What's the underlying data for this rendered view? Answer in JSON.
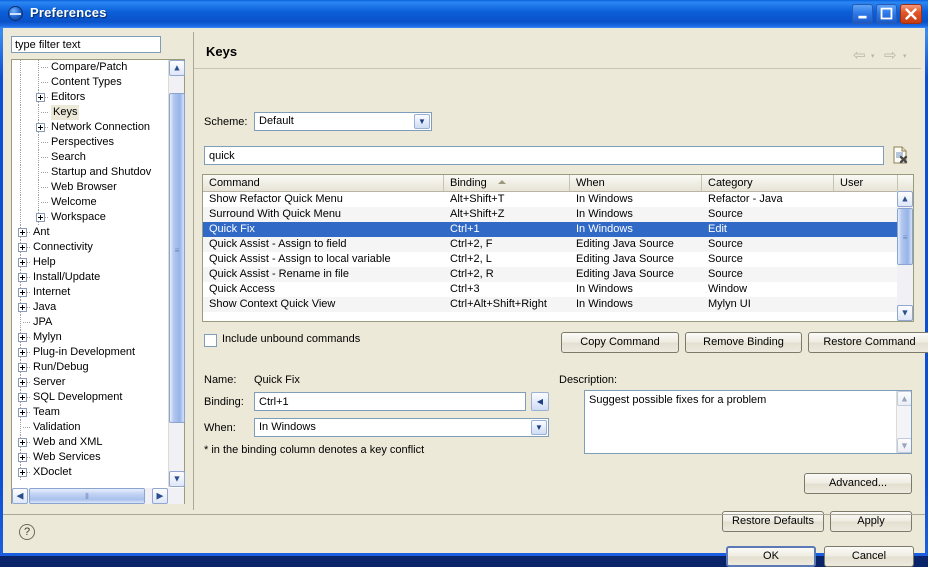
{
  "window": {
    "title": "Preferences",
    "icon": "eclipse-globe-icon",
    "minimize_label": "_",
    "maximize_label": "□",
    "close_label": "✕"
  },
  "sidebar": {
    "filter": {
      "value": "type filter text",
      "placeholder": "type filter text"
    },
    "items": [
      {
        "label": "Compare/Patch",
        "depth": 2,
        "expandable": false,
        "selected": false
      },
      {
        "label": "Content Types",
        "depth": 2,
        "expandable": false,
        "selected": false
      },
      {
        "label": "Editors",
        "depth": 2,
        "expandable": true,
        "selected": false
      },
      {
        "label": "Keys",
        "depth": 2,
        "expandable": false,
        "selected": true
      },
      {
        "label": "Network Connection",
        "depth": 2,
        "expandable": true,
        "selected": false
      },
      {
        "label": "Perspectives",
        "depth": 2,
        "expandable": false,
        "selected": false
      },
      {
        "label": "Search",
        "depth": 2,
        "expandable": false,
        "selected": false
      },
      {
        "label": "Startup and Shutdov",
        "depth": 2,
        "expandable": false,
        "selected": false
      },
      {
        "label": "Web Browser",
        "depth": 2,
        "expandable": false,
        "selected": false
      },
      {
        "label": "Welcome",
        "depth": 2,
        "expandable": false,
        "selected": false
      },
      {
        "label": "Workspace",
        "depth": 2,
        "expandable": true,
        "selected": false
      },
      {
        "label": "Ant",
        "depth": 1,
        "expandable": true,
        "selected": false
      },
      {
        "label": "Connectivity",
        "depth": 1,
        "expandable": true,
        "selected": false
      },
      {
        "label": "Help",
        "depth": 1,
        "expandable": true,
        "selected": false
      },
      {
        "label": "Install/Update",
        "depth": 1,
        "expandable": true,
        "selected": false
      },
      {
        "label": "Internet",
        "depth": 1,
        "expandable": true,
        "selected": false
      },
      {
        "label": "Java",
        "depth": 1,
        "expandable": true,
        "selected": false
      },
      {
        "label": "JPA",
        "depth": 1,
        "expandable": false,
        "selected": false
      },
      {
        "label": "Mylyn",
        "depth": 1,
        "expandable": true,
        "selected": false
      },
      {
        "label": "Plug-in Development",
        "depth": 1,
        "expandable": true,
        "selected": false
      },
      {
        "label": "Run/Debug",
        "depth": 1,
        "expandable": true,
        "selected": false
      },
      {
        "label": "Server",
        "depth": 1,
        "expandable": true,
        "selected": false
      },
      {
        "label": "SQL Development",
        "depth": 1,
        "expandable": true,
        "selected": false
      },
      {
        "label": "Team",
        "depth": 1,
        "expandable": true,
        "selected": false
      },
      {
        "label": "Validation",
        "depth": 1,
        "expandable": false,
        "selected": false
      },
      {
        "label": "Web and XML",
        "depth": 1,
        "expandable": true,
        "selected": false
      },
      {
        "label": "Web Services",
        "depth": 1,
        "expandable": true,
        "selected": false
      },
      {
        "label": "XDoclet",
        "depth": 1,
        "expandable": true,
        "selected": false
      }
    ]
  },
  "page": {
    "title": "Keys",
    "back_icon": "back-arrow-icon",
    "forward_icon": "forward-arrow-icon",
    "scheme": {
      "label": "Scheme:",
      "value": "Default"
    },
    "search": {
      "value": "quick",
      "placeholder": "type filter text",
      "clear_icon": "clear-filter-icon"
    },
    "table": {
      "columns": [
        "Command",
        "Binding",
        "When",
        "Category",
        "User"
      ],
      "sorted_column": "Binding",
      "sort_direction": "ascending",
      "rows": [
        {
          "command": "Show Refactor Quick Menu",
          "binding": "Alt+Shift+T",
          "when": "In Windows",
          "category": "Refactor - Java",
          "user": "",
          "selected": false
        },
        {
          "command": "Surround With Quick Menu",
          "binding": "Alt+Shift+Z",
          "when": "In Windows",
          "category": "Source",
          "user": "",
          "selected": false
        },
        {
          "command": "Quick Fix",
          "binding": "Ctrl+1",
          "when": "In Windows",
          "category": "Edit",
          "user": "",
          "selected": true
        },
        {
          "command": "Quick Assist - Assign to field",
          "binding": "Ctrl+2, F",
          "when": "Editing Java Source",
          "category": "Source",
          "user": "",
          "selected": false
        },
        {
          "command": "Quick Assist - Assign to local variable",
          "binding": "Ctrl+2, L",
          "when": "Editing Java Source",
          "category": "Source",
          "user": "",
          "selected": false
        },
        {
          "command": "Quick Assist - Rename in file",
          "binding": "Ctrl+2, R",
          "when": "Editing Java Source",
          "category": "Source",
          "user": "",
          "selected": false
        },
        {
          "command": "Quick Access",
          "binding": "Ctrl+3",
          "when": "In Windows",
          "category": "Window",
          "user": "",
          "selected": false
        },
        {
          "command": "Show Context Quick View",
          "binding": "Ctrl+Alt+Shift+Right",
          "when": "In Windows",
          "category": "Mylyn UI",
          "user": "",
          "selected": false
        }
      ]
    },
    "include_unbound": {
      "label": "Include unbound commands",
      "checked": false
    },
    "buttons": {
      "copy_command": "Copy Command",
      "remove_binding": "Remove Binding",
      "restore_command": "Restore Command",
      "advanced": "Advanced...",
      "restore_defaults": "Restore Defaults",
      "apply": "Apply"
    },
    "details": {
      "name_label": "Name:",
      "name_value": "Quick Fix",
      "binding_label": "Binding:",
      "binding_value": "Ctrl+1",
      "when_label": "When:",
      "when_value": "In Windows",
      "conflict_note": "* in the binding column denotes a key conflict",
      "description_label": "Description:",
      "description_value": "Suggest possible fixes for a problem"
    }
  },
  "footer": {
    "help_icon": "help-question-icon",
    "ok": "OK",
    "cancel": "Cancel"
  },
  "colors": {
    "titlebar_blue": "#0a4fd6",
    "selection_blue": "#3169c6",
    "dialog_bg": "#ece9d8",
    "close_red": "#e2582c"
  }
}
